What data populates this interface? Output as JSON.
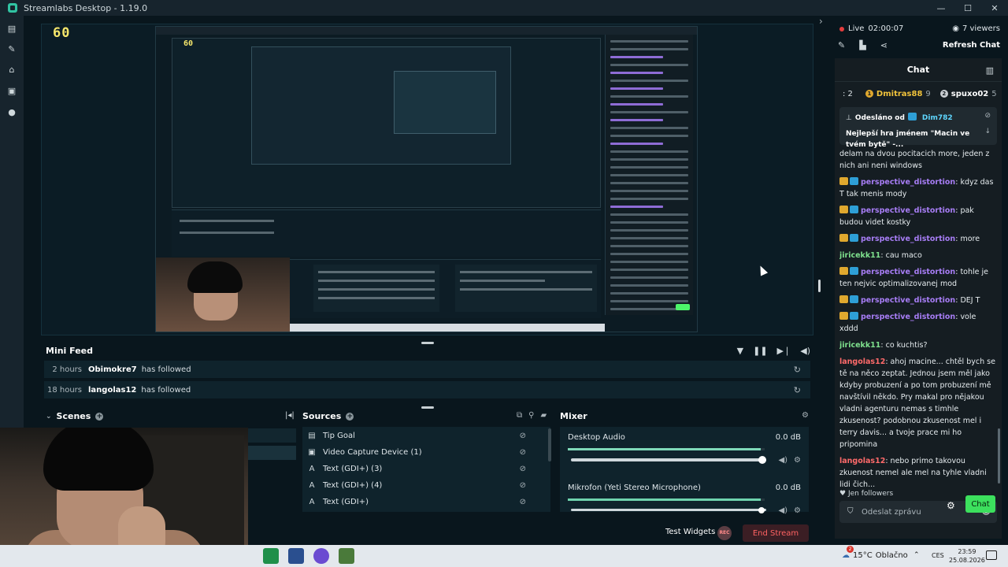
{
  "window": {
    "title": "Streamlabs Desktop - 1.19.0",
    "minimize": "—",
    "maximize": "☐",
    "close": "✕"
  },
  "preview": {
    "fps": "60",
    "nested_fps": "60"
  },
  "minifeed": {
    "title": "Mini Feed",
    "rows": [
      {
        "time": "2 hours",
        "user": "Obimokre7",
        "action": "has followed"
      },
      {
        "time": "18 hours",
        "user": "langolas12",
        "action": "has followed"
      }
    ]
  },
  "scenes": {
    "title": "Scenes"
  },
  "sources": {
    "title": "Sources",
    "items": [
      {
        "icon": "goal-icon",
        "label": "Tip Goal"
      },
      {
        "icon": "video-capture-icon",
        "label": "Video Capture Device (1)"
      },
      {
        "icon": "text-icon",
        "label": "Text (GDI+) (3)"
      },
      {
        "icon": "text-icon",
        "label": "Text (GDI+) (4)"
      },
      {
        "icon": "text-icon",
        "label": "Text (GDI+)"
      }
    ]
  },
  "mixer": {
    "title": "Mixer",
    "channels": [
      {
        "name": "Desktop Audio",
        "db": "0.0 dB",
        "level": 0.98
      },
      {
        "name": "Mikrofon (Yeti Stereo Microphone)",
        "db": "0.0 dB",
        "level": 0.98
      }
    ]
  },
  "footer": {
    "test_widgets": "Test Widgets",
    "rec": "REC",
    "end_stream": "End Stream"
  },
  "live": {
    "label": "Live",
    "duration": "02:00:07",
    "viewers": "7 viewers",
    "refresh_chat": "Refresh Chat"
  },
  "chat": {
    "title": "Chat",
    "leaderboard": [
      {
        "rank": "1",
        "name": "Dmitras88",
        "count": "9"
      },
      {
        "rank": "2",
        "name": "spuxo02",
        "count": "5"
      }
    ],
    "leaderboard_prefix": ": 2",
    "pinned": {
      "from_label": "Odesláno od",
      "from_user": "Dim782",
      "text": "Nejlepší hra jménem \"Macin ve tvém bytě\" -..."
    },
    "messages": [
      {
        "user": "",
        "color": "",
        "badges": false,
        "text": "delam na dvou pocitacich more, jeden z nich ani neni windows"
      },
      {
        "user": "perspective_distortion",
        "color": "purple",
        "badges": true,
        "text": "kdyz das T tak menis mody"
      },
      {
        "user": "perspective_distortion",
        "color": "purple",
        "badges": true,
        "text": "pak budou videt kostky"
      },
      {
        "user": "perspective_distortion",
        "color": "purple",
        "badges": true,
        "text": "more"
      },
      {
        "user": "jiricekk11",
        "color": "green",
        "badges": false,
        "text": "cau maco"
      },
      {
        "user": "perspective_distortion",
        "color": "purple",
        "badges": true,
        "text": "tohle je ten nejvic optimalizovanej mod"
      },
      {
        "user": "perspective_distortion",
        "color": "purple",
        "badges": true,
        "text": "DEJ T"
      },
      {
        "user": "perspective_distortion",
        "color": "purple",
        "badges": true,
        "text": "vole xddd"
      },
      {
        "user": "jiricekk11",
        "color": "green",
        "badges": false,
        "text": "co kuchtis?"
      },
      {
        "user": "langolas12",
        "color": "red",
        "badges": false,
        "text": "ahoj macine... chtěl bych se tě na něco zeptat. Jednou jsem měl jako kdyby probuzení a po tom probuzení mě navštívil někdo. Pry makal pro nějakou vladni agenturu nemas s timhle zkusenost? podobnou zkusenost mel i terry davis... a tvoje prace mi ho pripomina"
      },
      {
        "user": "langolas12",
        "color": "red",
        "badges": false,
        "text": "nebo primo takovou zkuenost nemel ale mel na tyhle vladni lidi čich..."
      }
    ],
    "followers_only": "Jen followers",
    "input_placeholder": "Odeslat zprávu",
    "send": "Chat"
  },
  "taskbar": {
    "temperature": "15°C",
    "weather": "Oblačno",
    "lang": "CES",
    "time": "23:59",
    "date": "25.08.2026",
    "notif_count": "2"
  }
}
